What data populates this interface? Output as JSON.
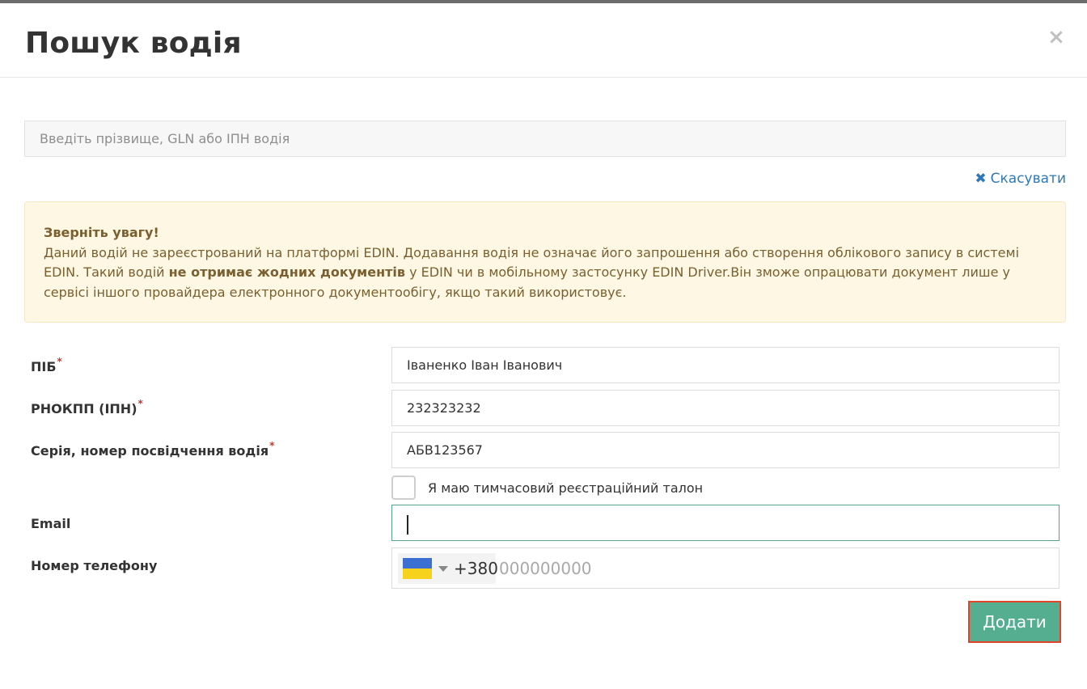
{
  "modal": {
    "title": "Пошук водія",
    "close_symbol": "×"
  },
  "search": {
    "placeholder": "Введіть прізвище, GLN або ІПН водія",
    "value": ""
  },
  "cancel": {
    "icon": "times-icon",
    "label": "Скасувати"
  },
  "alert": {
    "title": "Зверніть увагу!",
    "text_part1": "Даний водій не зареєстрований на платформі EDIN. Додавання водія не означає його запрошення або створення облікового запису в системі EDIN. Такий водій ",
    "text_bold": "не отримає жодних документів",
    "text_part2": " у EDIN чи в мобільному застосунку EDIN Driver.Він зможе опрацювати документ лише у сервісі іншого провайдера електронного документообігу, якщо такий використовує."
  },
  "form": {
    "required_mark": "*",
    "full_name": {
      "label": "ПІБ",
      "value": "Іваненко Іван Іванович"
    },
    "tax_id": {
      "label": "РНОКПП (ІПН)",
      "value": "232323232"
    },
    "license": {
      "label": "Серія, номер посвідчення водія",
      "value": "АБВ123567"
    },
    "temp_ticket": {
      "label": "Я маю тимчасовий реєстраційний талон",
      "checked": false
    },
    "email": {
      "label": "Email",
      "value": ""
    },
    "phone": {
      "label": "Номер телефону",
      "country_flag_colors": [
        "#3b6fd1",
        "#f7d21d"
      ],
      "dial_code": "+380",
      "placeholder": "000000000",
      "value": ""
    }
  },
  "actions": {
    "add_label": "Додати"
  },
  "colors": {
    "primary_button": "#55ae8f",
    "highlight_border": "#e0452a",
    "link": "#2f78b7",
    "alert_bg": "#fdf7e3",
    "alert_text": "#7a6030",
    "required": "#c0392b"
  }
}
